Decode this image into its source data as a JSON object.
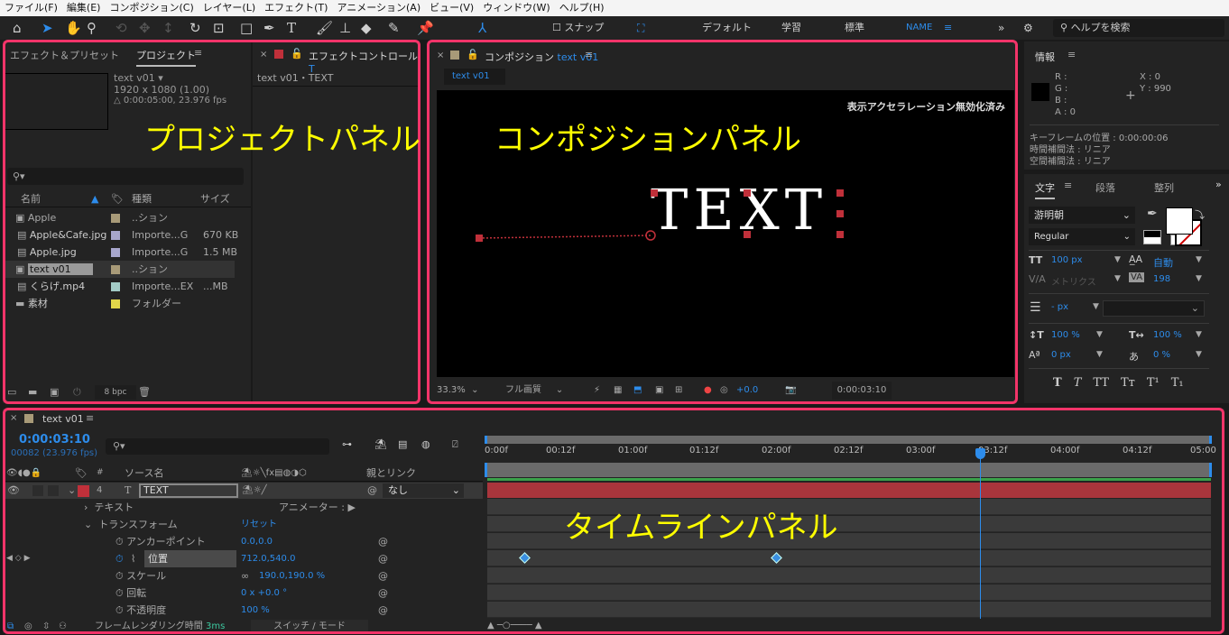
{
  "menu": [
    "ファイル(F)",
    "編集(E)",
    "コンポジション(C)",
    "レイヤー(L)",
    "エフェクト(T)",
    "アニメーション(A)",
    "ビュー(V)",
    "ウィンドウ(W)",
    "ヘルプ(H)"
  ],
  "toolbar": {
    "snap": "スナップ",
    "workspaces": [
      "デフォルト",
      "学習",
      "標準",
      "NAME"
    ],
    "help_search": "ヘルプを検索"
  },
  "project": {
    "tabs": [
      "エフェクト＆プリセット",
      "プロジェクト"
    ],
    "effect_tab": "エフェクトコントロール",
    "effect_tab_suffix": "T",
    "effect_layer": "text v01・TEXT",
    "comp_name": "text v01 ▾",
    "resolution": "1920 x 1080 (1.00)",
    "duration": "△ 0:00:05:00, 23.976 fps",
    "columns": [
      "名前",
      "種類",
      "サイズ"
    ],
    "items": [
      {
        "name": "Apple",
        "type": "..ション",
        "size": "",
        "color": "#a89a78"
      },
      {
        "name": "Apple&Cafe.jpg",
        "type": "Importe...G",
        "size": "670 KB",
        "color": "#a7a6cc"
      },
      {
        "name": "Apple.jpg",
        "type": "Importe...G",
        "size": "1.5 MB",
        "color": "#a7a6cc"
      },
      {
        "name": "text v01",
        "type": "..ション",
        "size": "",
        "color": "#a89a78"
      },
      {
        "name": "くらげ.mp4",
        "type": "Importe...EX",
        "size": "...MB",
        "color": "#a3cbc6"
      },
      {
        "name": "素材",
        "type": "フォルダー",
        "size": "",
        "color": "#e2d64a"
      }
    ],
    "bpc": "8 bpc"
  },
  "comp": {
    "tab": "コンポジション",
    "tab_name": "text v01",
    "sub_tab": "text v01",
    "accel": "表示アクセラレーション無効化済み",
    "text": "TEXT",
    "zoom": "33.3%",
    "quality": "フル画質",
    "exposure": "+0.0",
    "timecode": "0:00:03:10"
  },
  "info": {
    "title": "情報",
    "r": "R :",
    "g": "G :",
    "b": "B :",
    "a": "A :  0",
    "x": "X : 0",
    "y": "Y : 990",
    "kf_pos": "キーフレームの位置 : 0:00:00:06",
    "temporal": "時間補間法 : リニア",
    "spatial": "空間補間法 : リニア"
  },
  "character": {
    "tabs": [
      "文字",
      "段落",
      "整列"
    ],
    "font": "游明朝",
    "style": "Regular",
    "size": "100 px",
    "leading": "自動",
    "kerning": "メトリクス",
    "tracking": "198",
    "stroke": "-  px",
    "vscale": "100 %",
    "hscale": "100 %",
    "baseline": "0 px",
    "tsume": "0 %",
    "styles": [
      "T",
      "T",
      "TT",
      "Tт",
      "T¹",
      "T₁"
    ]
  },
  "timeline": {
    "tab": "text v01",
    "timecode": "0:00:03:10",
    "frames": "00082 (23.976 fps)",
    "col_source": "ソース名",
    "col_parent": "親とリンク",
    "layer": {
      "num": "4",
      "name": "TEXT",
      "parent": "なし"
    },
    "props": [
      {
        "name": "テキスト",
        "value": "",
        "extra": "アニメーター : ▶"
      },
      {
        "name": "トランスフォーム",
        "value": "リセット"
      },
      {
        "name": "アンカーポイント",
        "value": "0.0,0.0"
      },
      {
        "name": "位置",
        "value": "712.0,540.0"
      },
      {
        "name": "スケール",
        "value": "190.0,190.0 %"
      },
      {
        "name": "回転",
        "value": "0 x +0.0 °"
      },
      {
        "name": "不透明度",
        "value": "100 %"
      }
    ],
    "ruler": [
      "0:00f",
      "00:12f",
      "01:00f",
      "01:12f",
      "02:00f",
      "02:12f",
      "03:00f",
      "03:12f",
      "04:00f",
      "04:12f",
      "05:00"
    ],
    "render_label": "フレームレンダリング時間",
    "render_time": "3ms",
    "switch_mode": "スイッチ / モード",
    "playhead_time": "0:00:03:10",
    "keyframes": [
      "0:00:00:06",
      "0:00:02:00"
    ]
  },
  "annotations": {
    "project": "プロジェクトパネル",
    "comp": "コンポジションパネル",
    "timeline": "タイムラインパネル"
  },
  "colors": {
    "accent": "#2d8ceb",
    "highlight": "#f23469",
    "annotation": "#ffff00",
    "layer_label": "#c0303a"
  }
}
